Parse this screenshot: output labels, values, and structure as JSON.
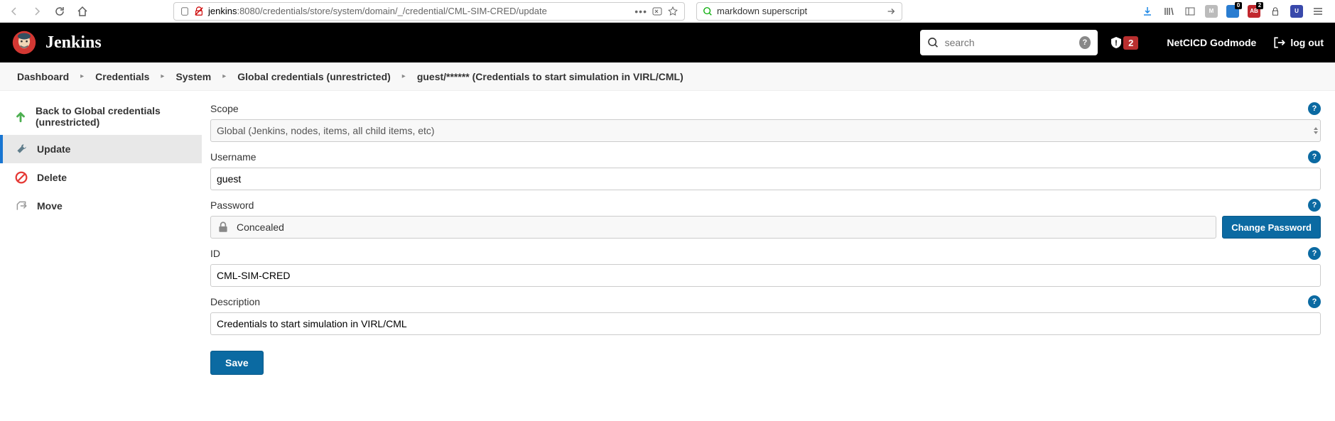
{
  "browser": {
    "url_host": "jenkins",
    "url_path": ":8080/credentials/store/system/domain/_/credential/CML-SIM-CRED/update",
    "search_value": "markdown superscript",
    "ext1_badge": "0",
    "ext2_badge": "2"
  },
  "header": {
    "app_name": "Jenkins",
    "search_placeholder": "search",
    "alert_count": "2",
    "username": "NetCICD Godmode",
    "logout_label": "log out"
  },
  "breadcrumb": {
    "items": [
      "Dashboard",
      "Credentials",
      "System",
      "Global credentials (unrestricted)",
      "guest/****** (Credentials to start simulation in VIRL/CML)"
    ]
  },
  "sidebar": {
    "items": [
      {
        "label": "Back to Global credentials (unrestricted)"
      },
      {
        "label": "Update"
      },
      {
        "label": "Delete"
      },
      {
        "label": "Move"
      }
    ]
  },
  "form": {
    "scope_label": "Scope",
    "scope_value": "Global (Jenkins, nodes, items, all child items, etc)",
    "username_label": "Username",
    "username_value": "guest",
    "password_label": "Password",
    "password_concealed": "Concealed",
    "change_password_label": "Change Password",
    "id_label": "ID",
    "id_value": "CML-SIM-CRED",
    "description_label": "Description",
    "description_value": "Credentials to start simulation in VIRL/CML",
    "save_label": "Save"
  }
}
